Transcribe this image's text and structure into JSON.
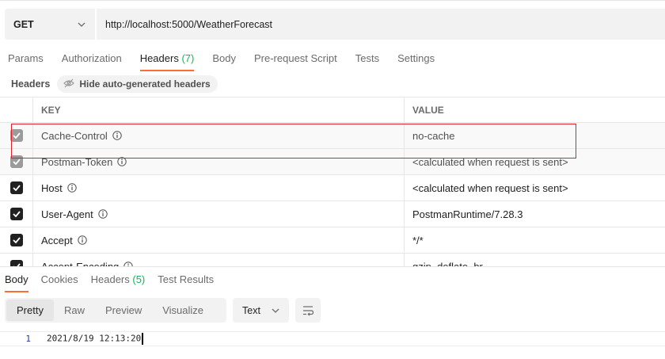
{
  "request": {
    "method": "GET",
    "url": "http://localhost:5000/WeatherForecast"
  },
  "request_tabs": [
    {
      "label": "Params",
      "count": "",
      "active": false
    },
    {
      "label": "Authorization",
      "count": "",
      "active": false
    },
    {
      "label": "Headers",
      "count": "(7)",
      "active": true
    },
    {
      "label": "Body",
      "count": "",
      "active": false
    },
    {
      "label": "Pre-request Script",
      "count": "",
      "active": false
    },
    {
      "label": "Tests",
      "count": "",
      "active": false
    },
    {
      "label": "Settings",
      "count": "",
      "active": false
    }
  ],
  "headers_section": {
    "title": "Headers",
    "hide_button_label": "Hide auto-generated headers"
  },
  "table": {
    "key_header": "KEY",
    "value_header": "VALUE",
    "rows": [
      {
        "key": "Cache-Control",
        "value": "no-cache",
        "checked": true,
        "disabled": true
      },
      {
        "key": "Postman-Token",
        "value": "<calculated when request is sent>",
        "checked": true,
        "disabled": true
      },
      {
        "key": "Host",
        "value": "<calculated when request is sent>",
        "checked": true,
        "disabled": false
      },
      {
        "key": "User-Agent",
        "value": "PostmanRuntime/7.28.3",
        "checked": true,
        "disabled": false
      },
      {
        "key": "Accept",
        "value": "*/*",
        "checked": true,
        "disabled": false
      },
      {
        "key": "Accept-Encoding",
        "value": "gzip, deflate, br",
        "checked": true,
        "disabled": false
      }
    ]
  },
  "response_tabs": [
    {
      "label": "Body",
      "count": "",
      "active": true
    },
    {
      "label": "Cookies",
      "count": "",
      "active": false
    },
    {
      "label": "Headers",
      "count": "(5)",
      "active": false
    },
    {
      "label": "Test Results",
      "count": "",
      "active": false
    }
  ],
  "view_modes": [
    {
      "label": "Pretty",
      "active": true
    },
    {
      "label": "Raw",
      "active": false
    },
    {
      "label": "Preview",
      "active": false
    },
    {
      "label": "Visualize",
      "active": false
    }
  ],
  "format_select": "Text",
  "response_body": {
    "line_number": "1",
    "text": "2021/8/19 12:13:20"
  },
  "colors": {
    "accent": "#ff6c37",
    "count_green": "#0cbb52",
    "highlight_red": "#e0202a"
  },
  "icons": {
    "method_dropdown": "chevron-down-icon",
    "hide_headers": "eye-off-icon",
    "info": "info-icon",
    "checkbox": "checkmark-icon",
    "format_dropdown": "chevron-down-icon",
    "wrap": "wrap-lines-icon"
  }
}
